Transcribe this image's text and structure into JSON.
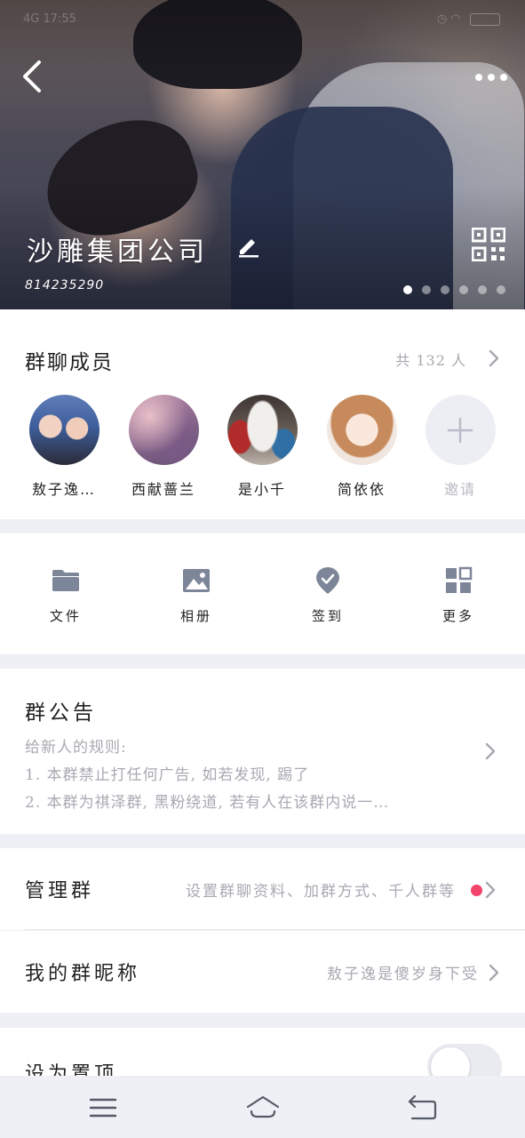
{
  "status_bar": {
    "left": "4G 17:55",
    "right": ""
  },
  "header": {
    "group_name": "沙雕集团公司",
    "group_id": "814235290",
    "carousel_pages": 6,
    "carousel_active_index": 0
  },
  "members": {
    "title": "群聊成员",
    "count_label": "共 132 人",
    "list": [
      {
        "name": "敖子逸…"
      },
      {
        "name": "西献蔷兰"
      },
      {
        "name": "是小千"
      },
      {
        "name": "简依依"
      },
      {
        "name": "邀请"
      }
    ]
  },
  "tools": [
    {
      "label": "文件",
      "icon": "folder-icon"
    },
    {
      "label": "相册",
      "icon": "album-icon"
    },
    {
      "label": "签到",
      "icon": "checkin-icon"
    },
    {
      "label": "更多",
      "icon": "more-grid-icon"
    }
  ],
  "notice": {
    "title": "群公告",
    "lines": [
      "给新人的规则:",
      "1. 本群禁止打任何广告, 如若发现, 踢了",
      "2. 本群为祺泽群, 黑粉绕道, 若有人在该群内说一…"
    ]
  },
  "manage": {
    "label": "管理群",
    "value": "设置群聊资料、加群方式、千人群等"
  },
  "nickname": {
    "label": "我的群昵称",
    "value": "敖子逸是傻岁身下受"
  },
  "pin": {
    "label": "设为置顶",
    "enabled": false
  },
  "colors": {
    "accent_red": "#f2436a",
    "icon_gray": "#7d8598",
    "muted_text": "#a9a9b2"
  }
}
